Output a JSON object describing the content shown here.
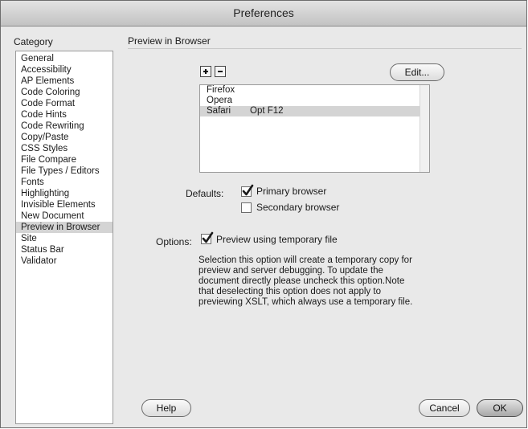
{
  "window": {
    "title": "Preferences"
  },
  "sidebar": {
    "label": "Category",
    "items": [
      "General",
      "Accessibility",
      "AP Elements",
      "Code Coloring",
      "Code Format",
      "Code Hints",
      "Code Rewriting",
      "Copy/Paste",
      "CSS Styles",
      "File Compare",
      "File Types / Editors",
      "Fonts",
      "Highlighting",
      "Invisible Elements",
      "New Document",
      "Preview in Browser",
      "Site",
      "Status Bar",
      "Validator"
    ],
    "selected": "Preview in Browser"
  },
  "panel": {
    "title": "Preview in Browser",
    "add_icon": "plus-icon",
    "remove_icon": "minus-icon",
    "edit_label": "Edit...",
    "browsers": [
      {
        "name": "Firefox",
        "shortcut": ""
      },
      {
        "name": "Opera",
        "shortcut": ""
      },
      {
        "name": "Safari",
        "shortcut": "Opt F12"
      }
    ],
    "selected_browser": "Safari",
    "defaults_label": "Defaults:",
    "primary_label": "Primary browser",
    "primary_checked": true,
    "secondary_label": "Secondary browser",
    "secondary_checked": false,
    "options_label": "Options:",
    "temp_label": "Preview using temporary file",
    "temp_checked": true,
    "description_lines": [
      "Selection this option will create a temporary copy for",
      "preview and server debugging. To update the",
      "document directly please uncheck this option.Note",
      "that deselecting this option does not apply to",
      "previewing XSLT, which always use a temporary file."
    ]
  },
  "footer": {
    "help_label": "Help",
    "cancel_label": "Cancel",
    "ok_label": "OK"
  }
}
